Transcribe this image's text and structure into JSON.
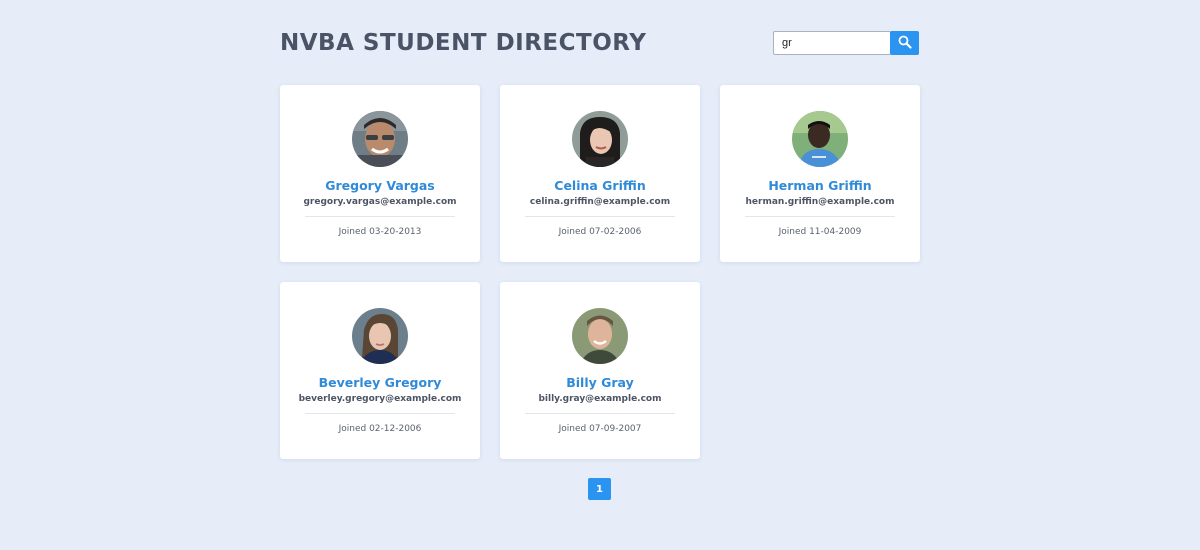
{
  "header": {
    "title": "NVBA STUDENT DIRECTORY"
  },
  "search": {
    "value": "gr",
    "placeholder": "",
    "icon": "search-icon",
    "button_color": "#2b93f0"
  },
  "students": [
    {
      "name": "Gregory Vargas",
      "email": "gregory.vargas@example.com",
      "joined": "Joined 03-20-2013"
    },
    {
      "name": "Celina Griffin",
      "email": "celina.griffin@example.com",
      "joined": "Joined 07-02-2006"
    },
    {
      "name": "Herman Griffin",
      "email": "herman.griffin@example.com",
      "joined": "Joined 11-04-2009"
    },
    {
      "name": "Beverley Gregory",
      "email": "beverley.gregory@example.com",
      "joined": "Joined 02-12-2006"
    },
    {
      "name": "Billy Gray",
      "email": "billy.gray@example.com",
      "joined": "Joined 07-09-2007"
    }
  ],
  "pagination": {
    "pages": [
      "1"
    ],
    "current": "1"
  },
  "colors": {
    "background": "#e6edf9",
    "accent": "#2b93f0",
    "name_link": "#2f8ad8"
  }
}
